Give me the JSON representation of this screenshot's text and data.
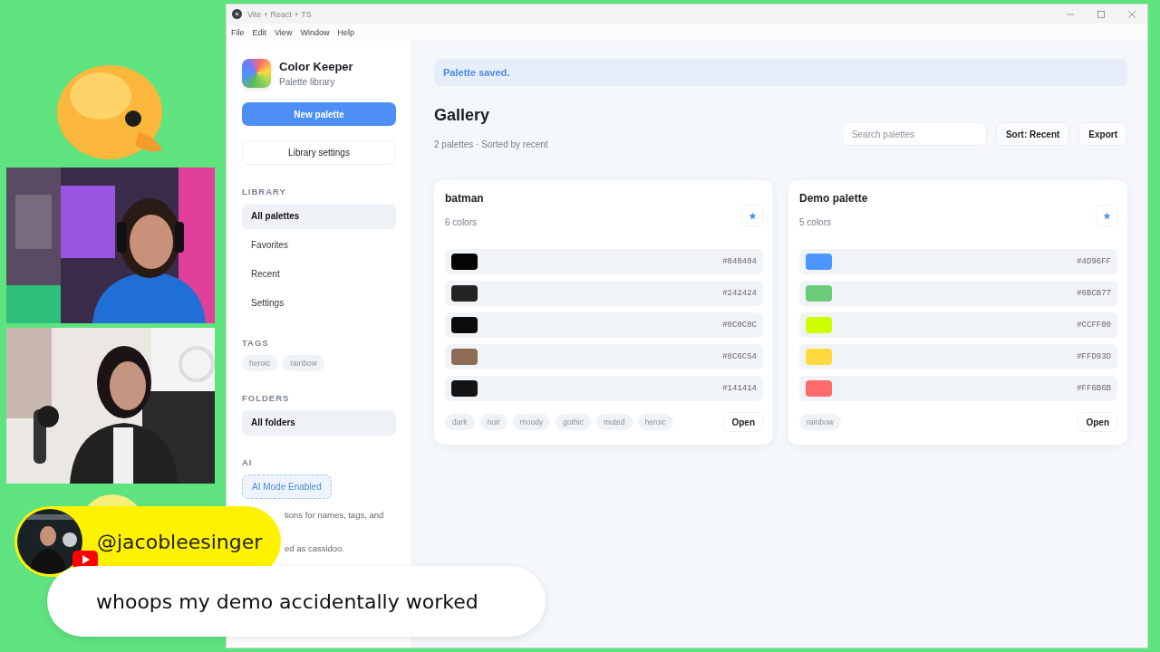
{
  "window": {
    "title": "Vite + React + TS"
  },
  "menu": [
    "File",
    "Edit",
    "View",
    "Window",
    "Help"
  ],
  "sidebar": {
    "app_name": "Color Keeper",
    "app_subtitle": "Palette library",
    "primary_button": "New palette",
    "secondary_button": "Library settings",
    "library": {
      "heading": "LIBRARY",
      "items": [
        {
          "label": "All palettes",
          "selected": true
        },
        {
          "label": "Favorites",
          "selected": false
        },
        {
          "label": "Recent",
          "selected": false
        },
        {
          "label": "Settings",
          "selected": false
        }
      ]
    },
    "tags": {
      "heading": "TAGS",
      "items": [
        "heroic",
        "rainbow"
      ]
    },
    "folders": {
      "heading": "FOLDERS",
      "items": [
        {
          "label": "All folders",
          "selected": true
        }
      ]
    },
    "ai": {
      "heading": "AI",
      "button": "AI Mode Enabled",
      "notes": [
        "tions for names, tags, and",
        "ed as cassidoo."
      ]
    }
  },
  "main": {
    "toast": "Palette saved.",
    "title": "Gallery",
    "subtitle": "2 palettes · Sorted by recent",
    "search": {
      "placeholder": "Search palettes"
    },
    "sort_button": "Sort: Recent",
    "export_button": "Export",
    "palettes": [
      {
        "name": "batman",
        "count": "6 colors",
        "open": "Open",
        "tags": [
          "dark",
          "noir",
          "moody",
          "gothic",
          "muted",
          "heroic"
        ],
        "colors": [
          {
            "color": "#040404",
            "hex": "#040404"
          },
          {
            "color": "#242424",
            "hex": "#242424"
          },
          {
            "color": "#0c0c0c",
            "hex": "#0C0C0C"
          },
          {
            "color": "#8c6c54",
            "hex": "#8C6C54"
          },
          {
            "color": "#141414",
            "hex": "#141414"
          }
        ]
      },
      {
        "name": "Demo palette",
        "count": "5 colors",
        "open": "Open",
        "tags": [
          "rainbow"
        ],
        "colors": [
          {
            "color": "#4d96ff",
            "hex": "#4D96FF"
          },
          {
            "color": "#6bcb77",
            "hex": "#6BCB77"
          },
          {
            "color": "#ccff00",
            "hex": "#CCFF00"
          },
          {
            "color": "#ffd93d",
            "hex": "#FFD93D"
          },
          {
            "color": "#ff6b6b",
            "hex": "#FF6B6B"
          }
        ]
      }
    ]
  },
  "chat": {
    "username": "@jacobleesinger",
    "message": "whoops my demo accidentally worked"
  }
}
